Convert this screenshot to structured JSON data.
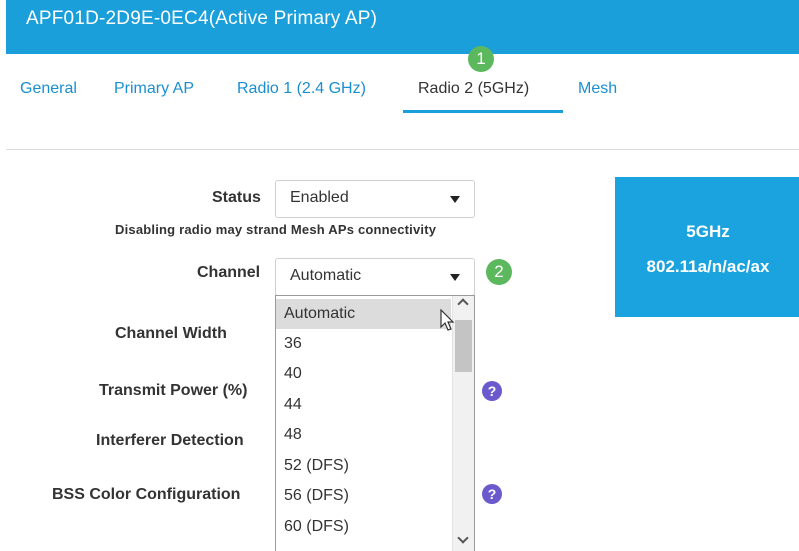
{
  "header": {
    "title": "APF01D-2D9E-0EC4(Active Primary AP)"
  },
  "tabs": [
    {
      "label": "General"
    },
    {
      "label": "Primary AP"
    },
    {
      "label": "Radio 1 (2.4 GHz)"
    },
    {
      "label": "Radio 2 (5GHz)",
      "active": true
    },
    {
      "label": "Mesh"
    }
  ],
  "steps": [
    "1",
    "2"
  ],
  "form": {
    "status_label": "Status",
    "status_value": "Enabled",
    "status_note": "Disabling radio may strand Mesh APs connectivity",
    "channel_label": "Channel",
    "channel_value": "Automatic",
    "channel_width_label": "Channel Width",
    "transmit_power_label": "Transmit Power (%)",
    "interferer_label": "Interferer Detection",
    "bss_color_label": "BSS Color Configuration"
  },
  "help_glyph": "?",
  "info_box": {
    "band": "5GHz",
    "standard": "802.11a/n/ac/ax"
  },
  "channel_options": [
    "Automatic",
    "36",
    "40",
    "44",
    "48",
    "52 (DFS)",
    "56 (DFS)",
    "60 (DFS)"
  ],
  "colors": {
    "header": "#1a9fdb",
    "tab_link": "#1a8fcf",
    "step_badge": "#5cb85c",
    "help_icon": "#6a5acd",
    "info_box": "#1aa3df"
  }
}
